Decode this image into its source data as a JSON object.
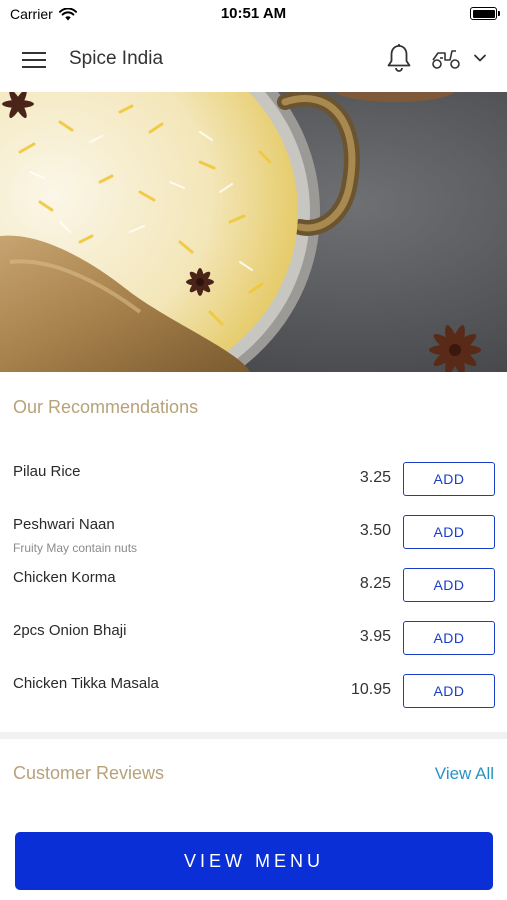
{
  "status_bar": {
    "carrier": "Carrier",
    "time": "10:51 AM"
  },
  "header": {
    "title": "Spice India",
    "icons": [
      "menu-icon",
      "bell-icon",
      "scooter-icon",
      "chevron-down-icon"
    ]
  },
  "hero": {
    "image_subject": "biryani-rice-with-chicken"
  },
  "recommendations": {
    "title": "Our Recommendations",
    "add_label": "ADD",
    "items": [
      {
        "name": "Pilau Rice",
        "description": "",
        "price": "3.25"
      },
      {
        "name": "Peshwari Naan",
        "description": "Fruity  May contain nuts",
        "price": "3.50"
      },
      {
        "name": "Chicken Korma",
        "description": "",
        "price": "8.25"
      },
      {
        "name": "2pcs Onion Bhaji",
        "description": "",
        "price": "3.95"
      },
      {
        "name": "Chicken Tikka Masala",
        "description": "",
        "price": "10.95"
      }
    ]
  },
  "reviews": {
    "title": "Customer Reviews",
    "view_all_label": "View All"
  },
  "footer": {
    "view_menu_label": "VIEW MENU"
  },
  "colors": {
    "accent_blue": "#0a2fd6",
    "section_gold": "#b7a27a",
    "link_blue": "#2a93c4"
  }
}
